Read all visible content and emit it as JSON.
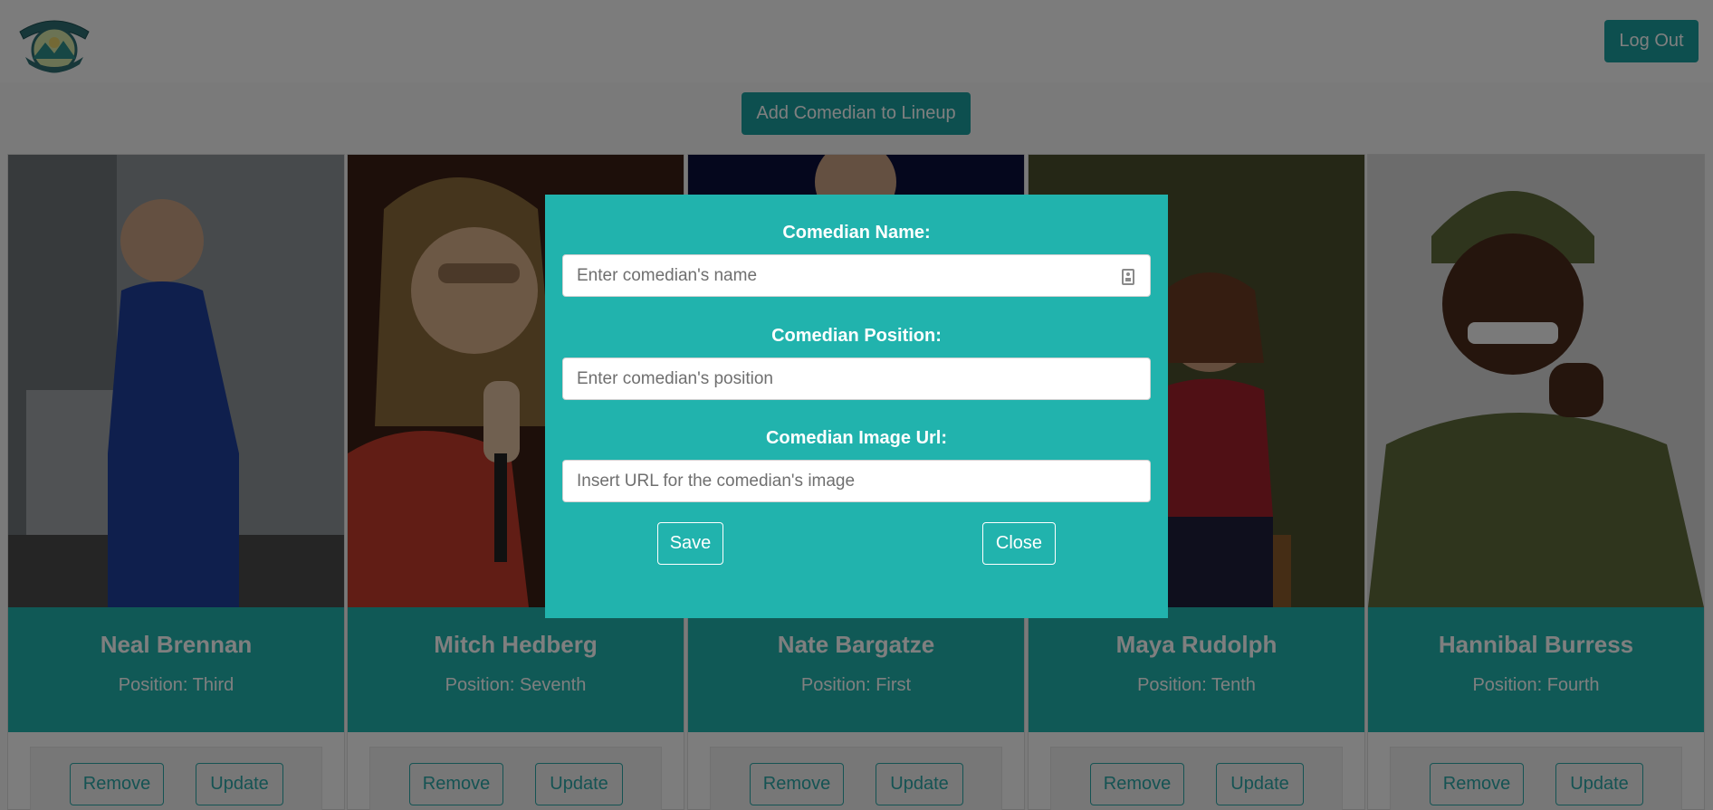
{
  "header": {
    "logout_label": "Log Out"
  },
  "main": {
    "add_label": "Add Comedian to Lineup"
  },
  "cards": [
    {
      "name": "Neal Brennan",
      "position": "Position: Third",
      "remove_label": "Remove",
      "update_label": "Update"
    },
    {
      "name": "Mitch Hedberg",
      "position": "Position: Seventh",
      "remove_label": "Remove",
      "update_label": "Update"
    },
    {
      "name": "Nate Bargatze",
      "position": "Position: First",
      "remove_label": "Remove",
      "update_label": "Update"
    },
    {
      "name": "Maya Rudolph",
      "position": "Position: Tenth",
      "remove_label": "Remove",
      "update_label": "Update"
    },
    {
      "name": "Hannibal Burress",
      "position": "Position: Fourth",
      "remove_label": "Remove",
      "update_label": "Update"
    }
  ],
  "modal": {
    "name_label": "Comedian Name:",
    "name_placeholder": "Enter comedian's name",
    "position_label": "Comedian Position:",
    "position_placeholder": "Enter comedian's position",
    "image_label": "Comedian Image Url:",
    "image_placeholder": "Insert URL for the comedian's image",
    "save_label": "Save",
    "close_label": "Close"
  },
  "colors": {
    "teal": "#21b3ad",
    "button_teal": "#1a9e9e",
    "overlay": "rgba(0,0,0,0.5)"
  }
}
